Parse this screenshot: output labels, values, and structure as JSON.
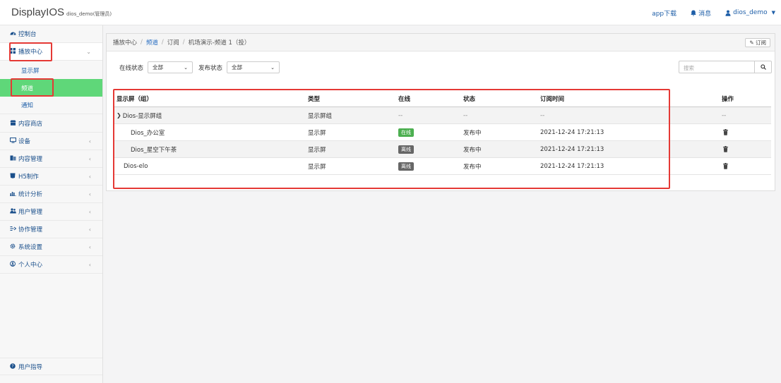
{
  "app": {
    "name": "DisplayIOS",
    "user_role": "dios_demo(管理员)"
  },
  "topnav": {
    "app_download": "app下载",
    "messages": "消息",
    "username": "dios_demo"
  },
  "sidebar": {
    "items": [
      {
        "label": "控制台",
        "icon": "dashboard-icon"
      },
      {
        "label": "播放中心",
        "icon": "grid-icon"
      },
      {
        "label": "内容商店",
        "icon": "store-icon"
      },
      {
        "label": "设备",
        "icon": "monitor-icon"
      },
      {
        "label": "内容管理",
        "icon": "content-icon"
      },
      {
        "label": "H5制作",
        "icon": "h5-icon"
      },
      {
        "label": "统计分析",
        "icon": "chart-icon"
      },
      {
        "label": "用户管理",
        "icon": "users-icon"
      },
      {
        "label": "协作管理",
        "icon": "collab-icon"
      },
      {
        "label": "系统设置",
        "icon": "gear-icon"
      },
      {
        "label": "个人中心",
        "icon": "user-circle-icon"
      }
    ],
    "sub_items": [
      {
        "label": "显示屏"
      },
      {
        "label": "频道"
      },
      {
        "label": "通知"
      }
    ],
    "guide": "用户指导"
  },
  "breadcrumb": {
    "items": [
      "播放中心",
      "频道",
      "订阅",
      "机场演示-频道 1（投）"
    ],
    "subscribe_button": "订阅"
  },
  "filters": {
    "online_label": "在线状态",
    "online_value": "全部",
    "publish_label": "发布状态",
    "publish_value": "全部",
    "search_placeholder": "搜索"
  },
  "table": {
    "headers": [
      "显示屏（组）",
      "类型",
      "在线",
      "状态",
      "订阅时间",
      "操作"
    ],
    "rows": [
      {
        "name": "Dios-显示屏组",
        "type": "显示屏组",
        "online": "--",
        "status": "--",
        "time": "--",
        "op": "--"
      },
      {
        "name": "Dios_办公室",
        "type": "显示屏",
        "online": "在线",
        "status": "发布中",
        "time": "2021-12-24 17:21:13"
      },
      {
        "name": "Dios_星空下午茶",
        "type": "显示屏",
        "online": "离线",
        "status": "发布中",
        "time": "2021-12-24 17:21:13"
      },
      {
        "name": "Dios-elo",
        "type": "显示屏",
        "online": "离线",
        "status": "发布中",
        "time": "2021-12-24 17:21:13"
      }
    ]
  },
  "colors": {
    "accent_green": "#5fd779",
    "online_badge": "#4caf50",
    "offline_badge": "#666666",
    "highlight_red": "#e53935",
    "link_blue": "#1f5fa8"
  }
}
